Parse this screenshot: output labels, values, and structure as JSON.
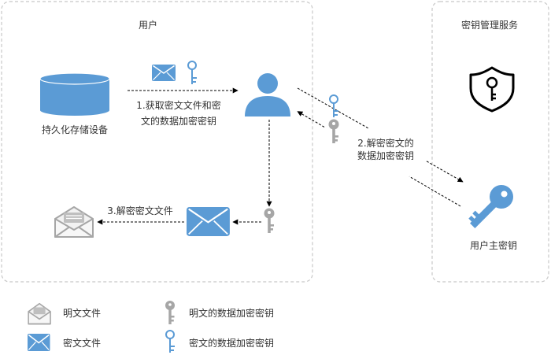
{
  "user_zone": {
    "label": "用户"
  },
  "kms_zone": {
    "label": "密钥管理服务"
  },
  "storage": {
    "label": "持久化存储设备"
  },
  "step1": {
    "line1": "1.获取密文文件和密",
    "line2": "文的数据加密密钥"
  },
  "step2": {
    "line1": "2.解密密文的",
    "line2": "数据加密密钥"
  },
  "step3": {
    "label": "3.解密密文文件"
  },
  "master_key": {
    "label": "用户主密钥"
  },
  "legend": {
    "plaintext_file": "明文文件",
    "plaintext_dek": "明文的数据加密密钥",
    "ciphertext_file": "密文文件",
    "ciphertext_dek": "密文的数据加密密钥"
  },
  "icons": {
    "storage": "database-icon",
    "user": "user-icon",
    "kms": "shield-key-icon",
    "master_key": "key-icon",
    "ciphertext_file": "envelope-closed-icon",
    "plaintext_file": "envelope-open-icon"
  },
  "colors": {
    "accent": "#5b9bd5",
    "plain": "#a6a6a6",
    "border": "#c8c8c8"
  }
}
